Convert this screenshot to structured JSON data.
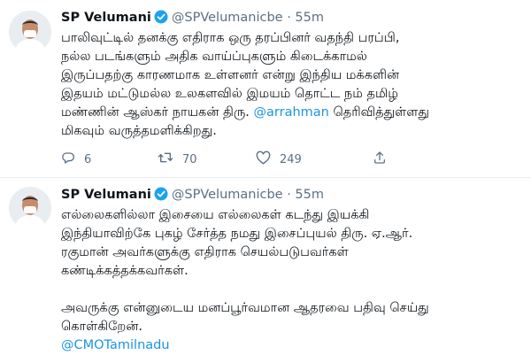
{
  "tweets": [
    {
      "name": "SP Velumani",
      "handle": "@SPVelumanicbe",
      "dot": "·",
      "time": "55m",
      "text_before": "பாலிவுட்டில் தனக்கு எதிராக ஒரு தரப்பினர் வதந்தி பரப்பி,\nநல்ல படங்களும் அதிக வாய்ப்புகளும் கிடைக்காமல்\nஇருப்பதற்கு காரணமாக உள்ளனர் என்று இந்திய மக்களின்\nஇதயம் மட்டுமல்ல உலகளவில் இமயம் தொட்ட நம் தமிழ்\nமண்ணின் ஆஸ்கர் நாயகன் திரு. ",
      "mention": "@arrahman",
      "text_after": " தெரிவித்துள்ளது\nமிகவும் வருத்தமளிக்கிறது.",
      "replies": "6",
      "retweets": "70",
      "likes": "249"
    },
    {
      "name": "SP Velumani",
      "handle": "@SPVelumanicbe",
      "dot": "·",
      "time": "55m",
      "text_before": "எல்லைகளில்லா இசையை எல்லைகள் கடந்து இயக்கி\nஇந்தியாவிற்கே புகழ் சேர்த்த நமது இசைப்புயல் திரு. ஏ.ஆர்.\nரகுமான் அவர்களுக்கு எதிராக செயல்படுபவர்கள்\nகண்டிக்கத்தக்கவர்கள்.\n\nஅவருக்கு என்னுடைய மனப்பூர்வமான ஆதரவை பதிவு செய்து\nகொள்கிறேன்.\n",
      "mention": "@CMOTamilnadu",
      "text_after": ""
    }
  ],
  "colors": {
    "mention": "#1b95e0",
    "verified": "#1da1f2",
    "secondary": "#5b7083"
  },
  "icons": [
    "verified-badge-icon",
    "reply-icon",
    "retweet-icon",
    "like-icon",
    "share-icon"
  ]
}
